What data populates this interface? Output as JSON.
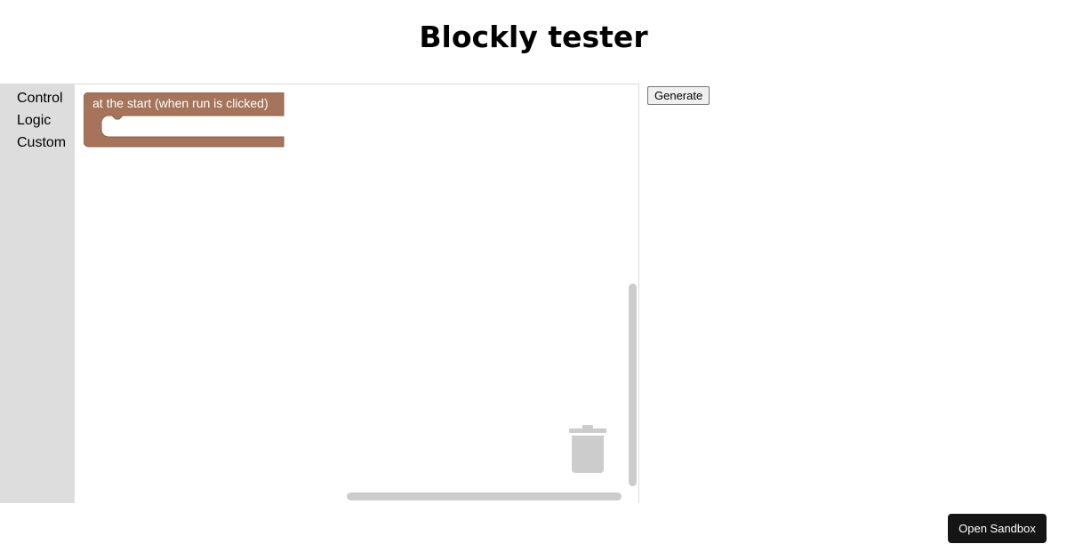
{
  "page": {
    "title": "Blockly tester"
  },
  "toolbox": {
    "items": [
      {
        "label": "Control"
      },
      {
        "label": "Logic"
      },
      {
        "label": "Custom"
      }
    ]
  },
  "workspace": {
    "blocks": [
      {
        "label": "at the start (when run is clicked)",
        "color": "#a5745a"
      }
    ],
    "icons": {
      "trash": "trash-icon"
    }
  },
  "actions": {
    "generate_label": "Generate",
    "sandbox_label": "Open Sandbox"
  },
  "colors": {
    "toolbox_bg": "#dddddd",
    "scrollbar": "#cccccc",
    "sandbox_button_bg": "#151515"
  }
}
